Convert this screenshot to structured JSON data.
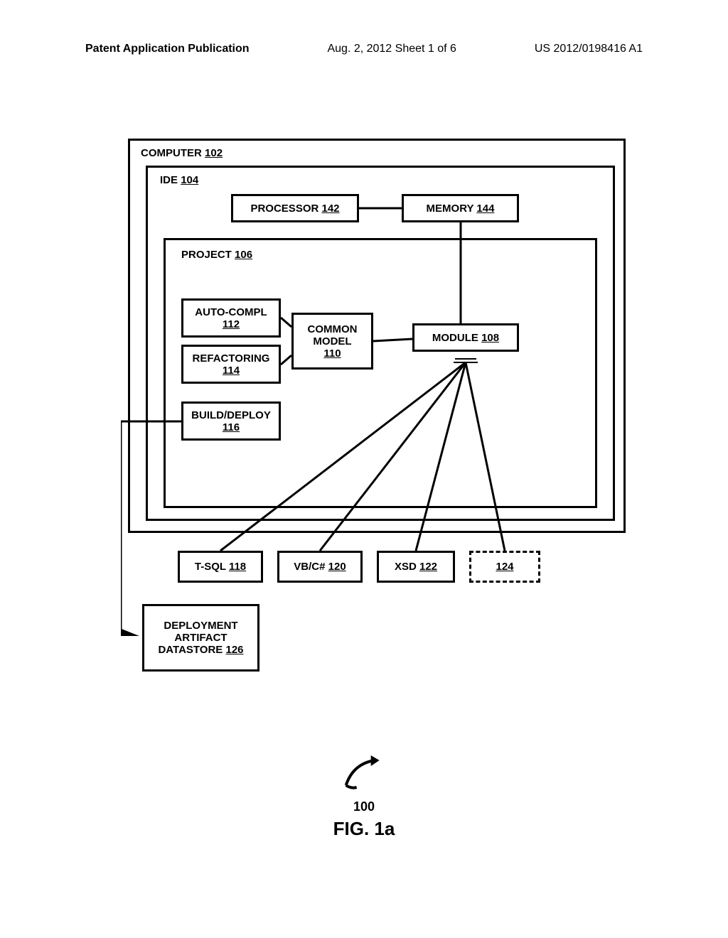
{
  "header": {
    "left": "Patent Application Publication",
    "center": "Aug. 2, 2012  Sheet 1 of 6",
    "right": "US 2012/0198416 A1"
  },
  "blocks": {
    "computer": {
      "label": "COMPUTER",
      "ref": "102"
    },
    "ide": {
      "label": "IDE",
      "ref": "104"
    },
    "project": {
      "label": "PROJECT",
      "ref": "106"
    },
    "processor": {
      "label": "PROCESSOR",
      "ref": "142"
    },
    "memory": {
      "label": "MEMORY",
      "ref": "144"
    },
    "autocompl": {
      "label": "AUTO-COMPL",
      "ref": "112"
    },
    "refactoring": {
      "label": "REFACTORING",
      "ref": "114"
    },
    "builddeploy": {
      "label": "BUILD/DEPLOY",
      "ref": "116"
    },
    "commonmodel": {
      "label": "COMMON MODEL",
      "ref": "110"
    },
    "module": {
      "label": "MODULE",
      "ref": "108"
    },
    "tsql": {
      "label": "T-SQL",
      "ref": "118"
    },
    "vbcs": {
      "label": "VB/C#",
      "ref": "120"
    },
    "xsd": {
      "label": "XSD",
      "ref": "122"
    },
    "ext": {
      "label": "",
      "ref": "124"
    },
    "deployment": {
      "line1": "DEPLOYMENT",
      "line2": "ARTIFACT",
      "line3": "DATASTORE",
      "ref": "126"
    }
  },
  "figure": {
    "ref": "100",
    "label": "FIG. 1a"
  }
}
